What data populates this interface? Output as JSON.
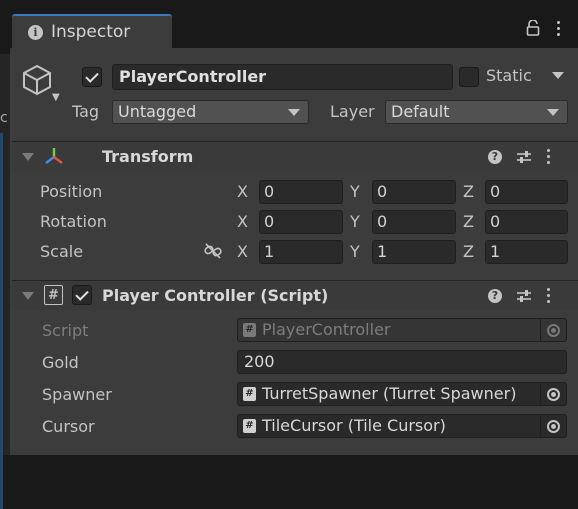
{
  "tab": {
    "label": "Inspector"
  },
  "gameobject": {
    "name": "PlayerController",
    "active": true,
    "static_label": "Static",
    "static_checked": false,
    "tag_label": "Tag",
    "tag_value": "Untagged",
    "layer_label": "Layer",
    "layer_value": "Default"
  },
  "transform": {
    "title": "Transform",
    "rows": [
      {
        "label": "Position",
        "x": "0",
        "y": "0",
        "z": "0"
      },
      {
        "label": "Rotation",
        "x": "0",
        "y": "0",
        "z": "0"
      },
      {
        "label": "Scale",
        "x": "1",
        "y": "1",
        "z": "1"
      }
    ],
    "axis": {
      "x": "X",
      "y": "Y",
      "z": "Z"
    }
  },
  "script_component": {
    "title": "Player Controller (Script)",
    "enabled": true,
    "fields": {
      "script_label": "Script",
      "script_value": "PlayerController",
      "gold_label": "Gold",
      "gold_value": "200",
      "spawner_label": "Spawner",
      "spawner_value": "TurretSpawner (Turret Spawner)",
      "cursor_label": "Cursor",
      "cursor_value": "TileCursor (Tile Cursor)"
    }
  },
  "icons": {
    "hash": "#",
    "help": "?"
  },
  "colors": {
    "panel_bg": "#3c3c3c",
    "field_bg": "#2a2a2a",
    "tab_accent": "#3a79bb"
  }
}
